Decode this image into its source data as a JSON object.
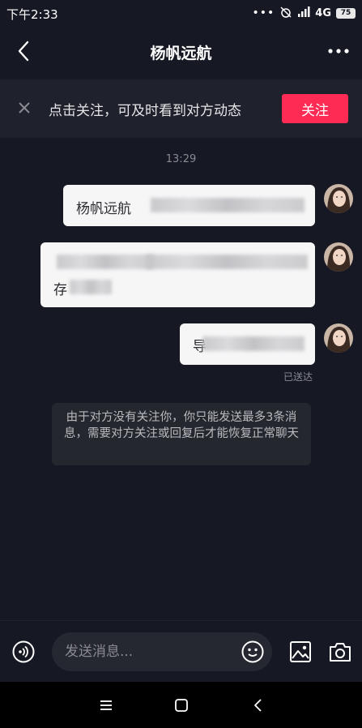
{
  "status_bar": {
    "time": "下午2:33",
    "dots": "•••",
    "network": "4G",
    "battery": "75"
  },
  "nav": {
    "title": "杨帆远航"
  },
  "banner": {
    "text": "点击关注，可及时看到对方动态",
    "follow_label": "关注"
  },
  "chat": {
    "timestamp": "13:29",
    "messages": [
      {
        "text": "杨帆远航"
      },
      {
        "line1_start": "",
        "line2_start": "存"
      },
      {
        "text": "导"
      }
    ],
    "delivered_label": "已送达",
    "notice": "由于对方没有关注你，你只能发送最多3条消息，需要对方关注或回复后才能恢复正常聊天"
  },
  "input": {
    "placeholder": "发送消息..."
  },
  "colors": {
    "background": "#161823",
    "accent": "#fe2c55",
    "bubble": "#f6f6f7"
  }
}
